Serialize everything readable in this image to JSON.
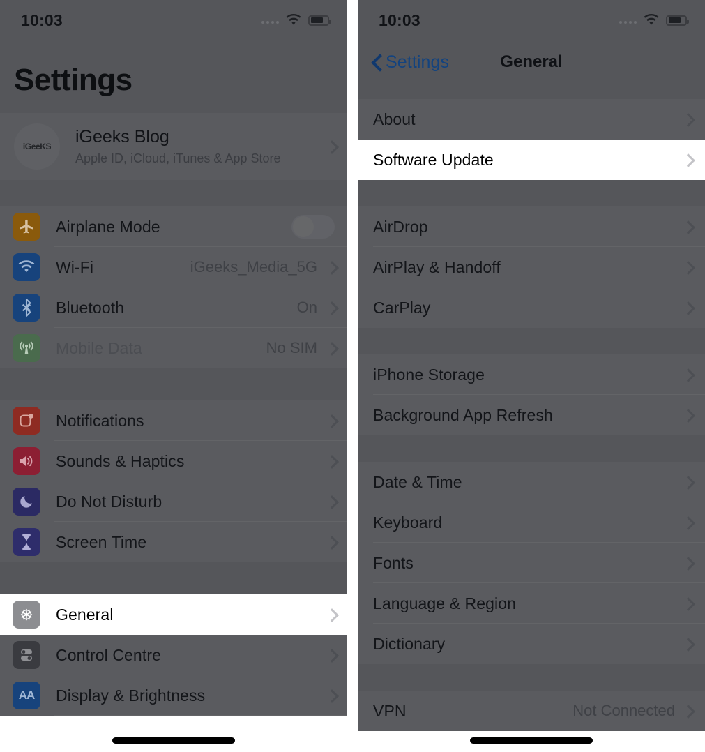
{
  "left_phone": {
    "statusbar": {
      "time": "10:03",
      "wifi_icon": "wifi-icon",
      "battery_icon": "battery-icon",
      "signal_icon": "signal-dots-icon"
    },
    "title": "Settings",
    "account": {
      "avatar_text": "iGeeKS",
      "name": "iGeeks Blog",
      "subtitle": "Apple ID, iCloud, iTunes & App Store"
    },
    "groups": [
      {
        "rows": [
          {
            "icon": "airplane-icon",
            "label": "Airplane Mode",
            "value": "",
            "control": "toggle",
            "toggle_on": false,
            "highlight": false
          },
          {
            "icon": "wifi-icon",
            "label": "Wi-Fi",
            "value": "iGeeks_Media_5G",
            "control": "chevron",
            "highlight": false
          },
          {
            "icon": "bluetooth-icon",
            "label": "Bluetooth",
            "value": "On",
            "control": "chevron",
            "highlight": false
          },
          {
            "icon": "mobile-data-icon",
            "label": "Mobile Data",
            "value": "No SIM",
            "control": "chevron",
            "muted": true,
            "highlight": false
          }
        ]
      },
      {
        "rows": [
          {
            "icon": "notifications-icon",
            "label": "Notifications",
            "value": "",
            "control": "chevron",
            "highlight": false
          },
          {
            "icon": "sounds-icon",
            "label": "Sounds & Haptics",
            "value": "",
            "control": "chevron",
            "highlight": false
          },
          {
            "icon": "do-not-disturb-icon",
            "label": "Do Not Disturb",
            "value": "",
            "control": "chevron",
            "highlight": false
          },
          {
            "icon": "screen-time-icon",
            "label": "Screen Time",
            "value": "",
            "control": "chevron",
            "highlight": false
          }
        ]
      },
      {
        "rows": [
          {
            "icon": "general-gear-icon",
            "label": "General",
            "value": "",
            "control": "chevron",
            "highlight": true
          },
          {
            "icon": "control-centre-icon",
            "label": "Control Centre",
            "value": "",
            "control": "chevron",
            "highlight": false
          },
          {
            "icon": "display-brightness-icon",
            "label": "Display & Brightness",
            "value": "",
            "control": "chevron",
            "highlight": false
          }
        ]
      }
    ]
  },
  "right_phone": {
    "statusbar": {
      "time": "10:03",
      "wifi_icon": "wifi-icon",
      "battery_icon": "battery-icon",
      "signal_icon": "signal-dots-icon"
    },
    "navbar": {
      "back_label": "Settings",
      "title": "General",
      "back_icon": "chevron-left-icon"
    },
    "groups": [
      {
        "rows": [
          {
            "label": "About",
            "value": "",
            "highlight": false
          },
          {
            "label": "Software Update",
            "value": "",
            "highlight": true
          }
        ]
      },
      {
        "rows": [
          {
            "label": "AirDrop",
            "value": "",
            "highlight": false
          },
          {
            "label": "AirPlay & Handoff",
            "value": "",
            "highlight": false
          },
          {
            "label": "CarPlay",
            "value": "",
            "highlight": false
          }
        ]
      },
      {
        "rows": [
          {
            "label": "iPhone Storage",
            "value": "",
            "highlight": false
          },
          {
            "label": "Background App Refresh",
            "value": "",
            "highlight": false
          }
        ]
      },
      {
        "rows": [
          {
            "label": "Date & Time",
            "value": "",
            "highlight": false
          },
          {
            "label": "Keyboard",
            "value": "",
            "highlight": false
          },
          {
            "label": "Fonts",
            "value": "",
            "highlight": false
          },
          {
            "label": "Language & Region",
            "value": "",
            "highlight": false
          },
          {
            "label": "Dictionary",
            "value": "",
            "highlight": false
          }
        ]
      },
      {
        "rows": [
          {
            "label": "VPN",
            "value": "Not Connected",
            "highlight": false
          }
        ]
      }
    ]
  },
  "colors": {
    "dim_bg": "#55565a",
    "dim_row": "#5a5b5f",
    "highlight_bg": "#ffffff",
    "link_blue": "#13437f",
    "airplane": "#8a5a0c",
    "wifi": "#17437c",
    "bluetooth": "#17437c",
    "mobile_data": "#4a6b4d",
    "notifications": "#8e2b22",
    "sounds": "#8c1f33",
    "dnd": "#2b2a63",
    "screen_time": "#2e2d6b",
    "general": "#8c8d91",
    "control_centre": "#3a3b40",
    "display": "#17437c"
  }
}
